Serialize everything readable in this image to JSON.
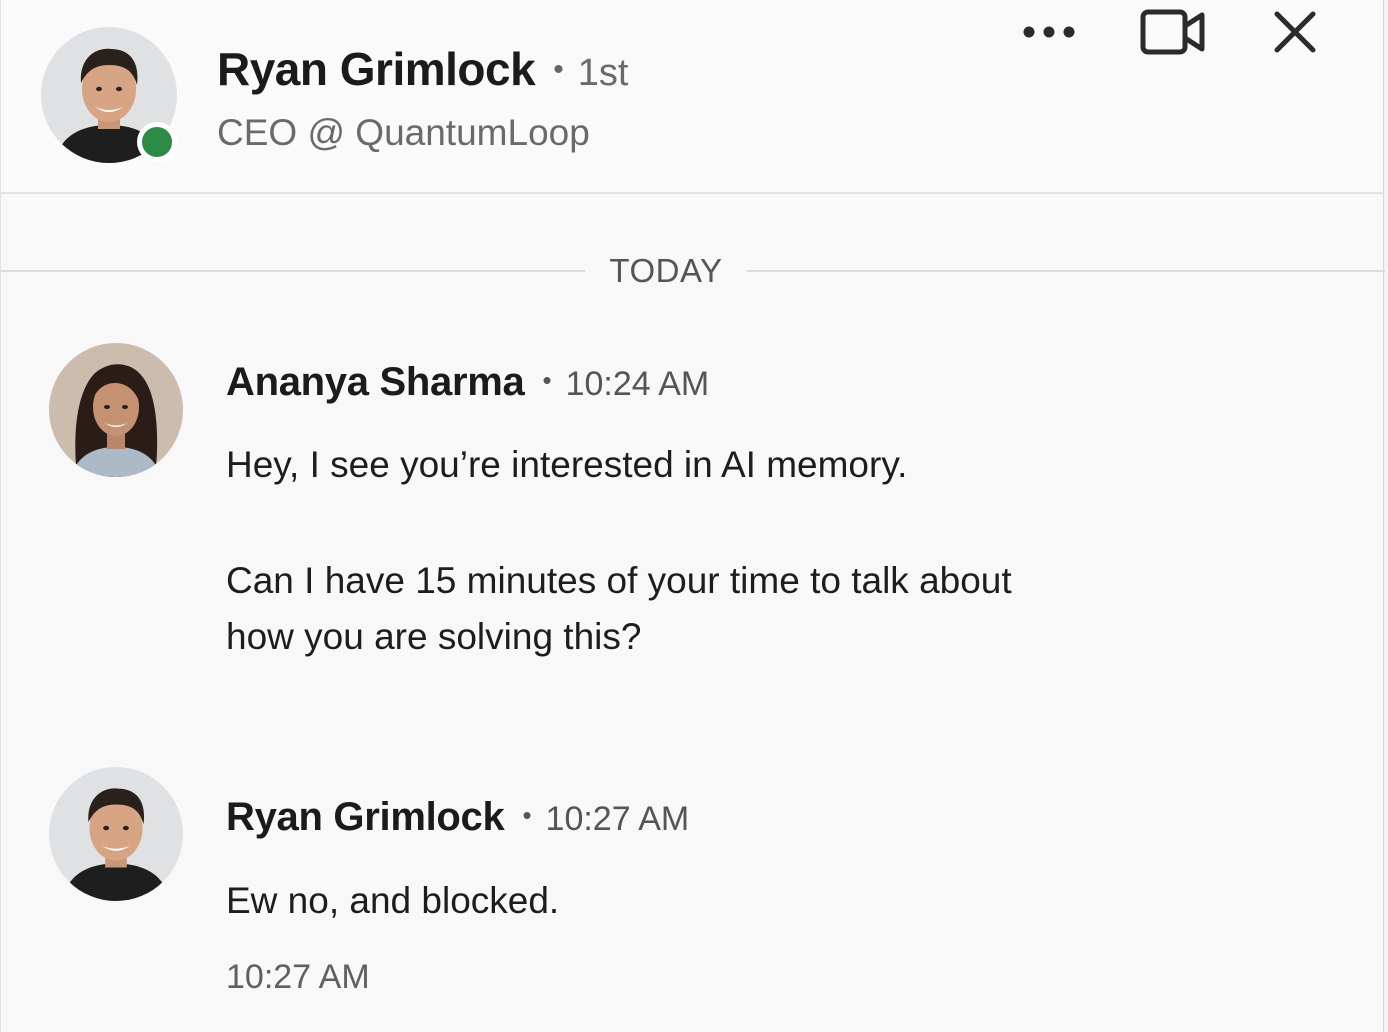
{
  "conversation": {
    "contact": {
      "name": "Ryan Grimlock",
      "degree": "1st",
      "headline": "CEO @ QuantumLoop",
      "online": true
    },
    "actions": {
      "more_icon": "more-horizontal-icon",
      "video_icon": "video-camera-icon",
      "close_icon": "close-icon"
    },
    "date_divider": "TODAY",
    "messages": [
      {
        "sender": "Ananya Sharma",
        "time": "10:24 AM",
        "lines": [
          "Hey, I see you’re interested in AI memory.",
          "Can I have 15 minutes of your time to talk about",
          "how you are solving this?"
        ]
      },
      {
        "sender": "Ryan Grimlock",
        "time": "10:27 AM",
        "lines": [
          "Ew no, and blocked."
        ],
        "footer_time": "10:27 AM"
      }
    ],
    "colors": {
      "presence": "#2e8b47",
      "background": "#f8f8f8"
    }
  }
}
